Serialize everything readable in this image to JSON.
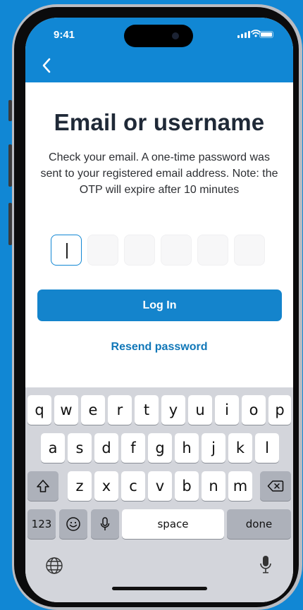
{
  "status_bar": {
    "time": "9:41"
  },
  "header": {
    "back_icon": "chevron-left-icon"
  },
  "main": {
    "title": "Email or username",
    "subtitle": "Check your email. A one-time password was sent to your registered email address. Note: the OTP will expire after 10 minutes",
    "otp": {
      "length": 6,
      "values": [
        "",
        "",
        "",
        "",
        "",
        ""
      ],
      "active_index": 0
    },
    "login_label": "Log In",
    "resend_label": "Resend password"
  },
  "keyboard": {
    "row1": [
      "q",
      "w",
      "e",
      "r",
      "t",
      "y",
      "u",
      "i",
      "o",
      "p"
    ],
    "row2": [
      "a",
      "s",
      "d",
      "f",
      "g",
      "h",
      "j",
      "k",
      "l"
    ],
    "row3": [
      "z",
      "x",
      "c",
      "v",
      "b",
      "n",
      "m"
    ],
    "numbers_label": "123",
    "space_label": "space",
    "done_label": "done"
  },
  "colors": {
    "brand": "#1187d4",
    "button": "#1484cc",
    "link": "#1077b8",
    "title": "#1f2937"
  }
}
